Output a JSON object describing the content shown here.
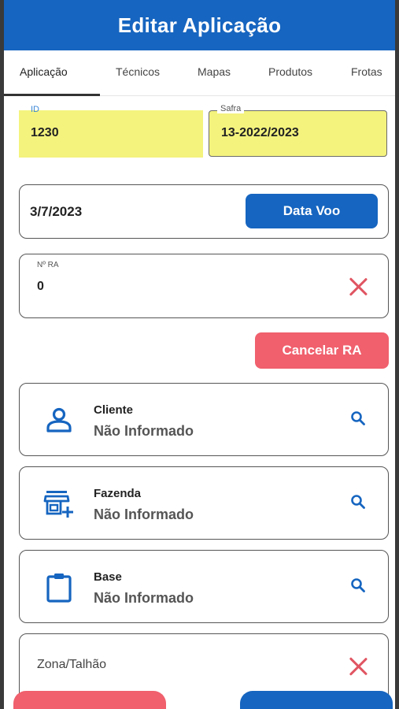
{
  "header": {
    "title": "Editar Aplicação"
  },
  "tabs": [
    {
      "label": "Aplicação",
      "active": true
    },
    {
      "label": "Técnicos",
      "active": false
    },
    {
      "label": "Mapas",
      "active": false
    },
    {
      "label": "Produtos",
      "active": false
    },
    {
      "label": "Frotas",
      "active": false
    }
  ],
  "fields": {
    "id": {
      "label": "ID",
      "value": "1230"
    },
    "safra": {
      "label": "Safra",
      "value": "13-2022/2023"
    }
  },
  "date": {
    "value": "3/7/2023",
    "button_label": "Data Voo"
  },
  "ra": {
    "label": "Nº RA",
    "value": "0",
    "cancel_label": "Cancelar RA"
  },
  "selectors": [
    {
      "title": "Cliente",
      "value": "Não Informado",
      "icon": "person-icon"
    },
    {
      "title": "Fazenda",
      "value": "Não Informado",
      "icon": "store-add-icon"
    },
    {
      "title": "Base",
      "value": "Não Informado",
      "icon": "clipboard-icon"
    }
  ],
  "zona": {
    "label": "Zona/Talhão"
  },
  "colors": {
    "primary": "#1665c0",
    "danger": "#f0606d",
    "highlight": "#f4f37e"
  }
}
